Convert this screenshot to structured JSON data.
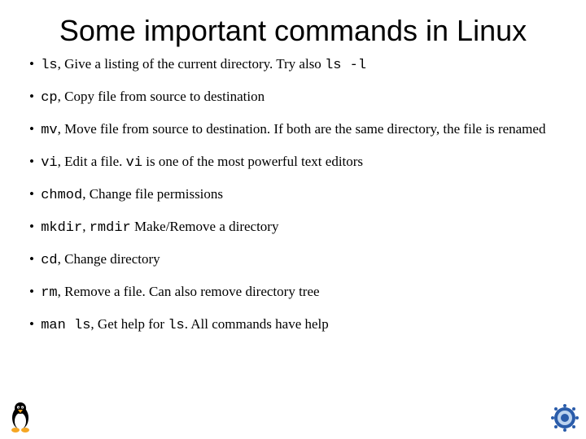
{
  "title": "Some important commands in Linux",
  "items": [
    {
      "cmd": "ls",
      "desc_before": ", Give a listing of the current directory. Try also ",
      "code_tail": "ls -l",
      "desc_after": ""
    },
    {
      "cmd": "cp",
      "desc_before": ", Copy file from source to destination",
      "code_tail": "",
      "desc_after": ""
    },
    {
      "cmd": "mv",
      "desc_before": ", Move file from source to destination. If both are the same directory, the file is renamed",
      "code_tail": "",
      "desc_after": ""
    },
    {
      "cmd": "vi",
      "desc_before": ", Edit a file. ",
      "code_tail": "vi",
      "desc_after": " is one of the most powerful text editors"
    },
    {
      "cmd": "chmod",
      "desc_before": ", Change file permissions",
      "code_tail": "",
      "desc_after": ""
    },
    {
      "cmd": "mkdir",
      "cmd2": "rmdir",
      "join": ", ",
      "desc_before": " Make/Remove a directory",
      "code_tail": "",
      "desc_after": ""
    },
    {
      "cmd": "cd",
      "desc_before": ", Change directory",
      "code_tail": "",
      "desc_after": ""
    },
    {
      "cmd": "rm",
      "desc_before": ", Remove a file. Can also remove directory tree",
      "code_tail": "",
      "desc_after": ""
    },
    {
      "cmd": "man ls",
      "desc_before": ", Get help for ",
      "code_tail": "ls",
      "desc_after": ". All commands have help"
    }
  ],
  "icons": {
    "tux": "tux-icon",
    "seal": "seal-icon"
  }
}
